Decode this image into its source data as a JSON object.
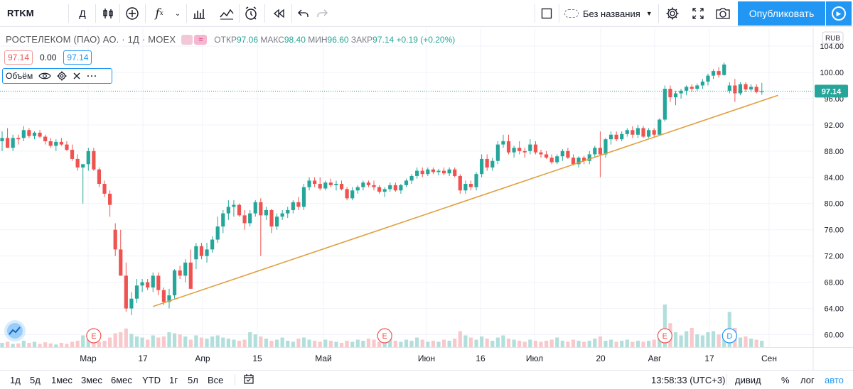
{
  "toolbar": {
    "symbol": "RTKM",
    "interval": "Д",
    "layout_name": "Без названия",
    "publish_label": "Опубликовать"
  },
  "legend": {
    "title": "РОСТЕЛЕКОМ (ПАО) АО. · 1Д · MOEX",
    "open_label": "ОТКР",
    "open": "97.06",
    "high_label": "МАКС",
    "high": "98.40",
    "low_label": "МИН",
    "low": "96.60",
    "close_label": "ЗАКР",
    "close": "97.14",
    "change": "+0.19 (+0.20%)",
    "value_red": "97.14",
    "value_zero": "0.00",
    "value_blue": "97.14",
    "volume_label": "Объём"
  },
  "colors": {
    "up": "#26a69a",
    "down": "#ef5350",
    "up_volume": "#b2dfdb",
    "down_volume": "#f8c8cc",
    "trendline": "#e0a040",
    "accent": "#2196f3"
  },
  "chart_data": {
    "type": "candlestick",
    "currency": "RUB",
    "y_range": [
      58,
      104
    ],
    "y_ticks": [
      "104.00",
      "100.00",
      "96.00",
      "92.00",
      "88.00",
      "84.00",
      "80.00",
      "76.00",
      "72.00",
      "68.00",
      "64.00",
      "60.00"
    ],
    "x_labels": [
      "Мар",
      "17",
      "Апр",
      "15",
      "Май",
      "Июн",
      "16",
      "Июл",
      "20",
      "Авг",
      "17",
      "Сен"
    ],
    "last_price": "97.14",
    "grid": true,
    "candles": [
      [
        89.5,
        91.0,
        88.0,
        90.0
      ],
      [
        90.0,
        91.5,
        88.5,
        88.5
      ],
      [
        88.5,
        90.5,
        88.0,
        90.0
      ],
      [
        90.0,
        90.5,
        89.0,
        89.8
      ],
      [
        90.0,
        91.8,
        89.5,
        91.2
      ],
      [
        91.2,
        91.5,
        90.0,
        90.3
      ],
      [
        90.3,
        91.0,
        89.8,
        90.8
      ],
      [
        90.8,
        91.2,
        90.0,
        90.2
      ],
      [
        90.2,
        90.5,
        89.0,
        89.5
      ],
      [
        89.5,
        90.0,
        88.5,
        88.8
      ],
      [
        88.8,
        89.8,
        88.0,
        89.4
      ],
      [
        89.4,
        90.0,
        88.8,
        89.0
      ],
      [
        89.0,
        89.5,
        88.0,
        88.2
      ],
      [
        88.2,
        89.0,
        86.5,
        86.8
      ],
      [
        86.8,
        87.5,
        85.0,
        85.5
      ],
      [
        85.5,
        86.0,
        80.0,
        86.0
      ],
      [
        86.0,
        88.5,
        85.0,
        88.0
      ],
      [
        88.0,
        88.5,
        85.0,
        85.2
      ],
      [
        85.2,
        85.5,
        82.5,
        83.0
      ],
      [
        83.0,
        83.5,
        81.0,
        81.5
      ],
      [
        81.5,
        82.0,
        78.0,
        79.8
      ],
      [
        76.0,
        77.0,
        72.0,
        73.0
      ],
      [
        73.0,
        76.0,
        69.0,
        69.0
      ],
      [
        69.0,
        71.0,
        63.5,
        64.0
      ],
      [
        64.0,
        66.5,
        63.0,
        65.5
      ],
      [
        65.5,
        68.5,
        64.8,
        67.5
      ],
      [
        67.5,
        68.5,
        66.5,
        68.0
      ],
      [
        68.0,
        68.5,
        66.8,
        67.2
      ],
      [
        67.2,
        69.5,
        66.5,
        69.0
      ],
      [
        69.0,
        69.5,
        66.0,
        66.8
      ],
      [
        66.8,
        67.2,
        64.5,
        65.0
      ],
      [
        65.0,
        67.0,
        64.0,
        66.0
      ],
      [
        66.0,
        70.0,
        65.5,
        69.8
      ],
      [
        69.8,
        70.5,
        68.5,
        69.0
      ],
      [
        69.0,
        71.5,
        68.0,
        71.0
      ],
      [
        71.0,
        73.0,
        67.0,
        67.0
      ],
      [
        71.5,
        74.0,
        70.0,
        73.5
      ],
      [
        73.5,
        74.0,
        71.5,
        72.0
      ],
      [
        72.0,
        74.0,
        71.0,
        73.0
      ],
      [
        73.0,
        75.0,
        72.5,
        74.5
      ],
      [
        74.5,
        78.0,
        74.0,
        76.5
      ],
      [
        76.5,
        79.0,
        75.5,
        78.5
      ],
      [
        78.5,
        80.5,
        77.5,
        79.5
      ],
      [
        79.5,
        80.5,
        78.0,
        79.8
      ],
      [
        79.8,
        80.0,
        78.0,
        78.2
      ],
      [
        78.2,
        79.0,
        76.0,
        77.0
      ],
      [
        77.0,
        79.0,
        76.5,
        78.5
      ],
      [
        78.5,
        80.5,
        78.0,
        80.2
      ],
      [
        80.2,
        80.8,
        72.0,
        78.2
      ],
      [
        78.2,
        79.5,
        77.5,
        79.0
      ],
      [
        79.0,
        79.2,
        75.5,
        76.5
      ],
      [
        76.5,
        78.5,
        76.0,
        78.0
      ],
      [
        78.0,
        79.0,
        77.5,
        78.5
      ],
      [
        78.5,
        79.5,
        77.8,
        79.0
      ],
      [
        79.0,
        80.5,
        78.5,
        80.2
      ],
      [
        80.2,
        81.0,
        79.0,
        79.5
      ],
      [
        79.5,
        83.0,
        79.0,
        82.5
      ],
      [
        82.5,
        84.0,
        82.0,
        83.5
      ],
      [
        83.5,
        84.0,
        82.5,
        83.0
      ],
      [
        83.0,
        84.0,
        82.0,
        82.3
      ],
      [
        82.3,
        83.5,
        82.0,
        83.2
      ],
      [
        83.2,
        83.8,
        82.5,
        82.8
      ],
      [
        82.8,
        83.5,
        82.0,
        83.0
      ],
      [
        83.0,
        83.5,
        82.0,
        82.2
      ],
      [
        82.2,
        82.5,
        80.5,
        80.8
      ],
      [
        80.8,
        82.5,
        80.5,
        82.0
      ],
      [
        82.0,
        82.8,
        81.5,
        82.5
      ],
      [
        82.5,
        83.5,
        82.0,
        83.2
      ],
      [
        83.2,
        83.5,
        82.5,
        82.8
      ],
      [
        82.8,
        83.5,
        82.0,
        82.5
      ],
      [
        82.5,
        82.8,
        81.5,
        81.8
      ],
      [
        81.8,
        82.5,
        81.0,
        82.2
      ],
      [
        82.2,
        83.2,
        81.8,
        82.8
      ],
      [
        82.8,
        83.2,
        81.8,
        82.0
      ],
      [
        82.0,
        83.0,
        81.5,
        82.8
      ],
      [
        82.8,
        83.8,
        82.5,
        83.5
      ],
      [
        83.5,
        84.5,
        83.0,
        84.2
      ],
      [
        84.2,
        85.5,
        83.8,
        85.0
      ],
      [
        85.0,
        85.5,
        84.0,
        84.5
      ],
      [
        84.5,
        85.5,
        84.2,
        85.2
      ],
      [
        85.2,
        85.5,
        84.5,
        84.8
      ],
      [
        84.8,
        85.3,
        84.3,
        85.0
      ],
      [
        85.0,
        85.5,
        84.3,
        84.6
      ],
      [
        84.6,
        85.5,
        84.2,
        85.2
      ],
      [
        85.2,
        85.5,
        84.0,
        84.2
      ],
      [
        84.2,
        84.5,
        81.5,
        82.0
      ],
      [
        82.0,
        83.5,
        81.5,
        83.0
      ],
      [
        83.0,
        83.5,
        82.0,
        82.5
      ],
      [
        82.5,
        84.8,
        82.0,
        84.5
      ],
      [
        84.5,
        87.5,
        84.0,
        86.8
      ],
      [
        86.8,
        87.5,
        85.0,
        85.5
      ],
      [
        85.5,
        87.0,
        85.0,
        86.5
      ],
      [
        86.5,
        89.5,
        86.0,
        89.0
      ],
      [
        89.0,
        90.5,
        88.5,
        89.5
      ],
      [
        89.5,
        90.5,
        87.5,
        87.8
      ],
      [
        87.8,
        88.8,
        87.0,
        88.5
      ],
      [
        88.5,
        89.5,
        87.5,
        88.0
      ],
      [
        88.0,
        88.5,
        87.0,
        87.8
      ],
      [
        88.0,
        89.8,
        87.5,
        89.0
      ],
      [
        89.0,
        89.5,
        87.5,
        87.8
      ],
      [
        87.8,
        88.2,
        87.0,
        87.5
      ],
      [
        87.5,
        88.0,
        86.8,
        87.0
      ],
      [
        87.0,
        87.5,
        86.0,
        86.3
      ],
      [
        86.3,
        87.5,
        86.0,
        87.2
      ],
      [
        87.2,
        88.3,
        86.5,
        88.0
      ],
      [
        88.0,
        88.5,
        86.8,
        87.0
      ],
      [
        87.0,
        87.5,
        85.8,
        86.0
      ],
      [
        86.0,
        87.2,
        85.5,
        87.0
      ],
      [
        87.0,
        87.3,
        86.0,
        86.5
      ],
      [
        86.5,
        88.0,
        86.0,
        87.5
      ],
      [
        87.5,
        88.8,
        87.0,
        88.5
      ],
      [
        88.5,
        91.0,
        84.0,
        87.5
      ],
      [
        87.5,
        90.0,
        87.0,
        89.8
      ],
      [
        89.8,
        91.0,
        89.0,
        90.5
      ],
      [
        90.5,
        91.0,
        89.5,
        89.8
      ],
      [
        89.8,
        91.0,
        89.5,
        90.6
      ],
      [
        90.6,
        91.5,
        90.2,
        91.2
      ],
      [
        91.2,
        91.8,
        90.0,
        90.5
      ],
      [
        90.5,
        92.0,
        90.0,
        91.5
      ],
      [
        91.5,
        91.8,
        90.0,
        90.2
      ],
      [
        90.2,
        91.5,
        90.0,
        91.2
      ],
      [
        91.2,
        91.5,
        90.2,
        90.5
      ],
      [
        90.5,
        93.0,
        90.5,
        92.8
      ],
      [
        92.8,
        98.0,
        92.5,
        97.5
      ],
      [
        97.5,
        98.0,
        95.5,
        96.2
      ],
      [
        96.2,
        97.2,
        95.0,
        96.8
      ],
      [
        96.8,
        97.5,
        96.0,
        97.2
      ],
      [
        97.2,
        98.0,
        96.5,
        97.8
      ],
      [
        97.8,
        98.2,
        97.0,
        97.5
      ],
      [
        97.5,
        98.3,
        97.2,
        98.0
      ],
      [
        98.0,
        99.0,
        97.5,
        98.6
      ],
      [
        98.6,
        99.8,
        98.0,
        99.5
      ],
      [
        99.5,
        100.5,
        99.0,
        100.2
      ],
      [
        100.2,
        100.8,
        99.2,
        99.6
      ],
      [
        99.6,
        101.5,
        99.5,
        101.2
      ],
      [
        97.2,
        98.5,
        96.8,
        98.0
      ],
      [
        98.0,
        99.0,
        95.5,
        96.8
      ],
      [
        96.8,
        98.5,
        96.5,
        98.2
      ],
      [
        98.2,
        98.5,
        97.0,
        97.4
      ],
      [
        97.4,
        98.2,
        97.0,
        97.8
      ],
      [
        97.8,
        98.2,
        96.8,
        97.0
      ],
      [
        97.0,
        98.4,
        96.6,
        97.14
      ]
    ],
    "volume_levels": [
      0.08,
      0.1,
      0.06,
      0.07,
      0.12,
      0.08,
      0.1,
      0.06,
      0.09,
      0.07,
      0.05,
      0.08,
      0.06,
      0.1,
      0.12,
      0.22,
      0.16,
      0.14,
      0.1,
      0.12,
      0.18,
      0.26,
      0.28,
      0.35,
      0.25,
      0.2,
      0.18,
      0.14,
      0.22,
      0.18,
      0.2,
      0.28,
      0.26,
      0.24,
      0.2,
      0.14,
      0.22,
      0.18,
      0.16,
      0.2,
      0.22,
      0.18,
      0.16,
      0.14,
      0.12,
      0.14,
      0.28,
      0.24,
      0.2,
      0.16,
      0.12,
      0.14,
      0.18,
      0.12,
      0.1,
      0.16,
      0.18,
      0.14,
      0.12,
      0.1,
      0.14,
      0.12,
      0.1,
      0.08,
      0.12,
      0.1,
      0.14,
      0.12,
      0.16,
      0.14,
      0.1,
      0.12,
      0.16,
      0.12,
      0.1,
      0.14,
      0.12,
      0.18,
      0.14,
      0.1,
      0.12,
      0.1,
      0.14,
      0.12,
      0.16,
      0.3,
      0.22,
      0.18,
      0.14,
      0.2,
      0.16,
      0.12,
      0.18,
      0.22,
      0.16,
      0.14,
      0.12,
      0.1,
      0.14,
      0.12,
      0.1,
      0.12,
      0.14,
      0.18,
      0.12,
      0.1,
      0.14,
      0.12,
      0.1,
      0.12,
      0.16,
      0.2,
      0.12,
      0.14,
      0.1,
      0.12,
      0.14,
      0.1,
      0.12,
      0.1,
      0.12,
      0.14,
      0.16,
      0.8,
      0.45,
      0.28,
      0.22,
      0.3,
      0.36,
      0.24,
      0.22,
      0.28,
      0.3,
      0.24,
      0.26,
      0.66,
      0.36,
      0.18,
      0.2,
      0.16,
      0.14,
      0.12
    ],
    "event_markers": [
      {
        "label": "E",
        "candle": 17
      },
      {
        "label": "E",
        "candle": 71
      },
      {
        "label": "E",
        "candle": 123
      },
      {
        "label": "D",
        "candle": 135
      }
    ],
    "trendline": {
      "from": {
        "candle": 28,
        "price": 64.3
      },
      "to": {
        "candle": 144,
        "price": 96.5
      }
    }
  },
  "bottom": {
    "ranges": [
      "1д",
      "5д",
      "1мес",
      "3мес",
      "6мес",
      "YTD",
      "1г",
      "5л",
      "Все"
    ],
    "time": "13:58:33 (UTC+3)",
    "dividends": "дивид",
    "percent": "%",
    "log": "лог",
    "auto": "авто"
  }
}
